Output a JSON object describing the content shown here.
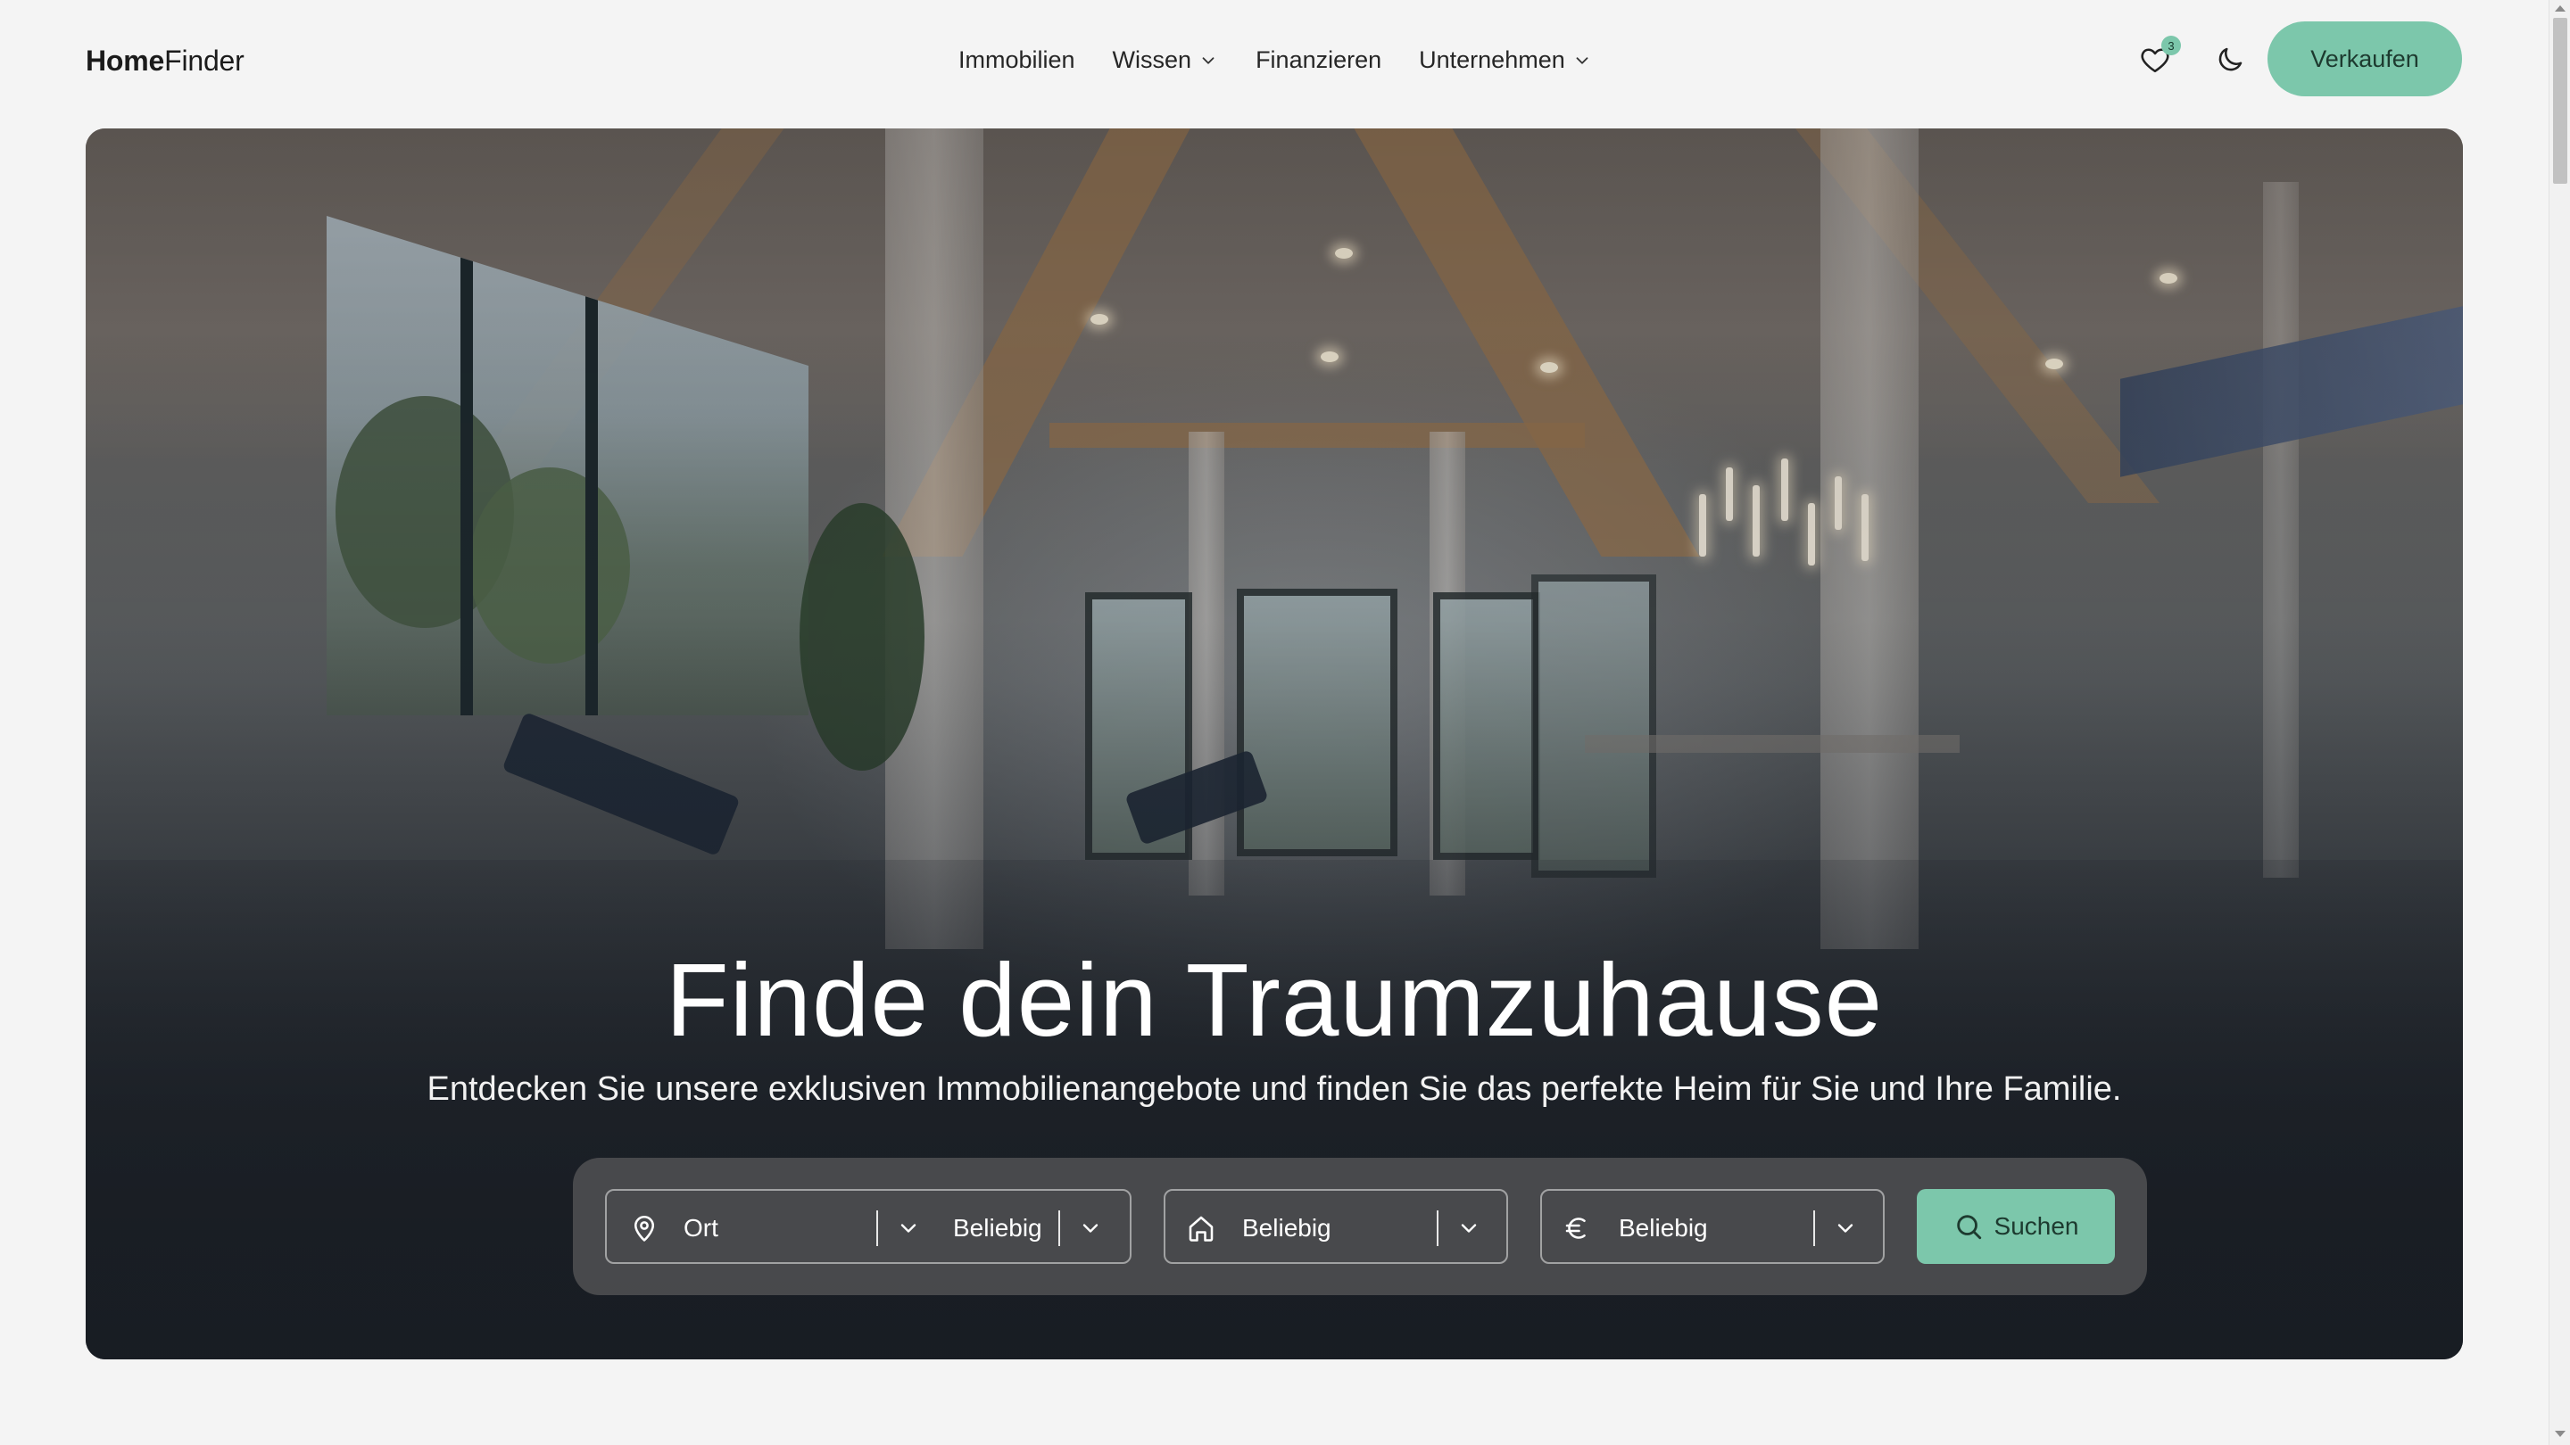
{
  "brand": {
    "bold": "Home",
    "light": "Finder"
  },
  "nav": {
    "items": [
      {
        "label": "Immobilien",
        "has_dropdown": false
      },
      {
        "label": "Wissen",
        "has_dropdown": true
      },
      {
        "label": "Finanzieren",
        "has_dropdown": false
      },
      {
        "label": "Unternehmen",
        "has_dropdown": true
      }
    ]
  },
  "header": {
    "favorites_count": "3",
    "favorites_icon": "heart-icon",
    "theme_icon": "moon-icon",
    "sell_label": "Verkaufen"
  },
  "hero": {
    "title": "Finde dein Traumzuhause",
    "subtitle": "Entdecken Sie unsere exklusiven Immobilienangebote und finden Sie das perfekte Heim für Sie und Ihre Familie."
  },
  "search": {
    "location_placeholder": "Ort",
    "radius_value": "Beliebig",
    "type_value": "Beliebig",
    "price_value": "Beliebig",
    "submit_label": "Suchen",
    "icons": {
      "location": "map-pin-icon",
      "type": "house-icon",
      "price": "euro-icon",
      "submit": "search-icon"
    }
  },
  "colors": {
    "accent": "#7cc7ab",
    "accent_text": "#1d3a2f",
    "page_bg": "#f4f4f4"
  }
}
